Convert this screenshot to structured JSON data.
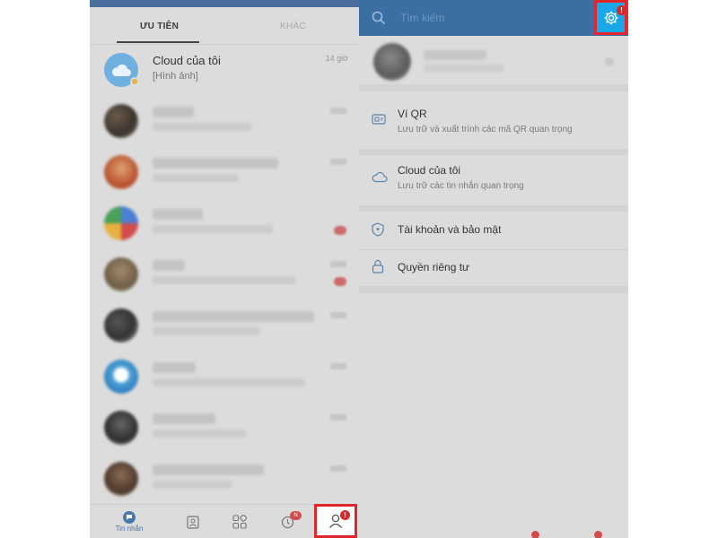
{
  "left_screen": {
    "tabs": {
      "priority": "ƯU TIÊN",
      "other": "KHÁC"
    },
    "chats": [
      {
        "name": "Cloud của tôi",
        "preview": "[Hình ảnh]",
        "time": "14 giờ"
      }
    ],
    "bottom_nav": {
      "messages_label": "Tin nhắn",
      "timeline_count": "N",
      "alert_mark": "!"
    }
  },
  "right_screen": {
    "search": {
      "placeholder": "Tìm kiếm"
    },
    "alert_mark": "!",
    "menu": [
      {
        "title": "Ví QR",
        "subtitle": "Lưu trữ và xuất trình các mã QR quan trọng",
        "icon": "qr-wallet-icon"
      },
      {
        "title": "Cloud của tôi",
        "subtitle": "Lưu trữ các tin nhắn quan trọng",
        "icon": "cloud-icon"
      },
      {
        "title": "Tài khoản và bảo mật",
        "icon": "shield-icon"
      },
      {
        "title": "Quyền riêng tư",
        "icon": "lock-icon"
      }
    ]
  },
  "colors": {
    "header_blue": "#3b6ea3",
    "gear_highlight": "#1aa7e8",
    "annotation_red": "#e0262b",
    "dim_overlay": "#dcdcdc"
  }
}
